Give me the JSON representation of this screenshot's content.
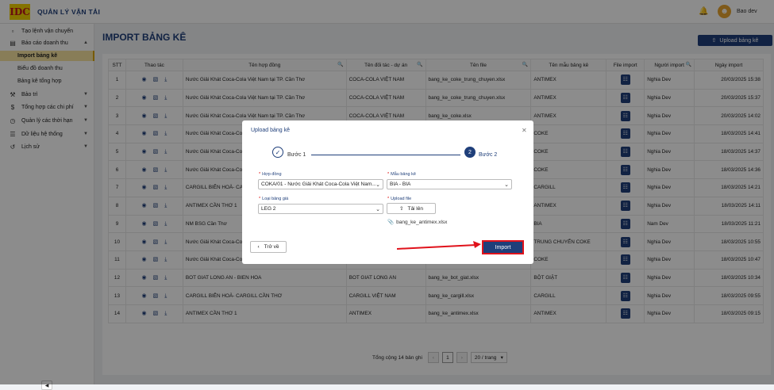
{
  "header": {
    "logo_text": "IDC",
    "app_title": "QUẢN LÝ VẬN TẢI",
    "username": "Bao dev",
    "bell_icon": "bell-icon",
    "avatar_icon": "user-avatar-icon"
  },
  "sidebar": {
    "items": [
      {
        "label": "Tạo lệnh vận chuyển",
        "icon": "truck-icon"
      },
      {
        "label": "Báo cáo doanh thu",
        "icon": "chart-icon"
      },
      {
        "label": "Bảo trì",
        "icon": "wrench-icon"
      },
      {
        "label": "Tổng hợp các chi phí",
        "icon": "dollar-icon"
      },
      {
        "label": "Quản lý các thời hạn",
        "icon": "clock-icon"
      },
      {
        "label": "Dữ liệu hệ thống",
        "icon": "database-icon"
      },
      {
        "label": "Lịch sử",
        "icon": "history-icon"
      }
    ],
    "subitems": [
      "Import bảng kê",
      "Biểu đồ doanh thu",
      "Bảng kê tổng hợp"
    ]
  },
  "page": {
    "title": "IMPORT BẢNG KÊ",
    "upload_button": "Upload bảng kê"
  },
  "table": {
    "headers": [
      "STT",
      "Thao tác",
      "Tên hợp đồng",
      "Tên đối tác - dự án",
      "Tên file",
      "Tên mẫu bảng kê",
      "File import",
      "Người import",
      "Ngày import"
    ],
    "rows": [
      {
        "stt": "1",
        "contract": "Nước Giải Khát Coca-Cola Việt Nam tại TP. Cần Thơ",
        "partner": "COCA-COLA VIỆT NAM",
        "file": "bang_ke_coke_trung_chuyen.xlsx",
        "template": "ANTIMEX",
        "user": "Nghia Dev",
        "date": "20/03/2025 15:38"
      },
      {
        "stt": "2",
        "contract": "Nước Giải Khát Coca-Cola Việt Nam tại TP. Cần Thơ",
        "partner": "COCA-COLA VIỆT NAM",
        "file": "bang_ke_coke_trung_chuyen.xlsx",
        "template": "ANTIMEX",
        "user": "Nghia Dev",
        "date": "20/03/2025 15:37"
      },
      {
        "stt": "3",
        "contract": "Nước Giải Khát Coca-Cola Việt Nam tại TP. Cần Thơ",
        "partner": "COCA-COLA VIỆT NAM",
        "file": "bang_ke_coke.xlsx",
        "template": "ANTIMEX",
        "user": "Nghia Dev",
        "date": "20/03/2025 14:02"
      },
      {
        "stt": "4",
        "contract": "Nước Giải Khát Coca-Cola",
        "partner": "",
        "file": "",
        "template": "COKE",
        "user": "Nghia Dev",
        "date": "18/03/2025 14:41"
      },
      {
        "stt": "5",
        "contract": "Nước Giải Khát Coca-Cola",
        "partner": "",
        "file": "",
        "template": "COKE",
        "user": "Nghia Dev",
        "date": "18/03/2025 14:37"
      },
      {
        "stt": "6",
        "contract": "Nước Giải Khát Coca-Cola",
        "partner": "",
        "file": "",
        "template": "COKE",
        "user": "Nghia Dev",
        "date": "18/03/2025 14:36"
      },
      {
        "stt": "7",
        "contract": "CARGILL BIÊN HOÀ- CAR",
        "partner": "",
        "file": "",
        "template": "CARGILL",
        "user": "Nghia Dev",
        "date": "18/03/2025 14:21"
      },
      {
        "stt": "8",
        "contract": "ANTIMEX CẦN THƠ 1",
        "partner": "",
        "file": "",
        "template": "ANTIMEX",
        "user": "Nghia Dev",
        "date": "18/03/2025 14:11"
      },
      {
        "stt": "9",
        "contract": "NM BSG Cần Thơ",
        "partner": "",
        "file": "",
        "template": "BIA",
        "user": "Nam Dev",
        "date": "18/03/2025 11:21"
      },
      {
        "stt": "10",
        "contract": "Nước Giải Khát Coca-Cola",
        "partner": "",
        "file": "",
        "template": "TRUNG CHUYỂN COKE",
        "user": "Nghia Dev",
        "date": "18/03/2025 10:55"
      },
      {
        "stt": "11",
        "contract": "Nước Giải Khát Coca-Cola",
        "partner": "",
        "file": "",
        "template": "COKE",
        "user": "Nghia Dev",
        "date": "18/03/2025 10:47"
      },
      {
        "stt": "12",
        "contract": "BOT GIAT LONG AN - BIEN HOA",
        "partner": "BOT GIAT LONG AN",
        "file": "bang_ke_bot_giat.xlsx",
        "template": "BỘT GIẶT",
        "user": "Nghia Dev",
        "date": "18/03/2025 10:34"
      },
      {
        "stt": "13",
        "contract": "CARGILL BIÊN HOÀ- CARGILL CẦN THƠ",
        "partner": "CARGILL VIỆT NAM",
        "file": "bang_ke_cargill.xlsx",
        "template": "CARGILL",
        "user": "Nghia Dev",
        "date": "18/03/2025 09:55"
      },
      {
        "stt": "14",
        "contract": "ANTIMEX CẦN THƠ 1",
        "partner": "ANTIMEX",
        "file": "bang_ke_antimex.xlsx",
        "template": "ANTIMEX",
        "user": "Nghia Dev",
        "date": "18/03/2025 09:15"
      }
    ]
  },
  "pagination": {
    "total": "Tổng cộng 14 bản ghi",
    "current": "1",
    "page_size": "20 / trang"
  },
  "modal": {
    "title": "Upload bảng kê",
    "step1": "Bước 1",
    "step2": "Bước 2",
    "step2_number": "2",
    "contract_label": "Hợp đồng",
    "contract_value": "COKA/01 - Nước Giải Khát Coca-Cola Việt Nam...",
    "template_label": "Mẫu bảng kê",
    "template_value": "BIA - BIA",
    "price_label": "Loại bảng giá",
    "price_value": "LEG 2",
    "upload_label": "Upload file",
    "upload_button": "Tải lên",
    "file_name": "bang_ke_antimex.xlsx",
    "back_button": "Trở về",
    "import_button": "Import"
  },
  "colors": {
    "primary": "#1f3f7a",
    "highlight": "#e0121b",
    "active_bg": "#f7e3a0"
  }
}
